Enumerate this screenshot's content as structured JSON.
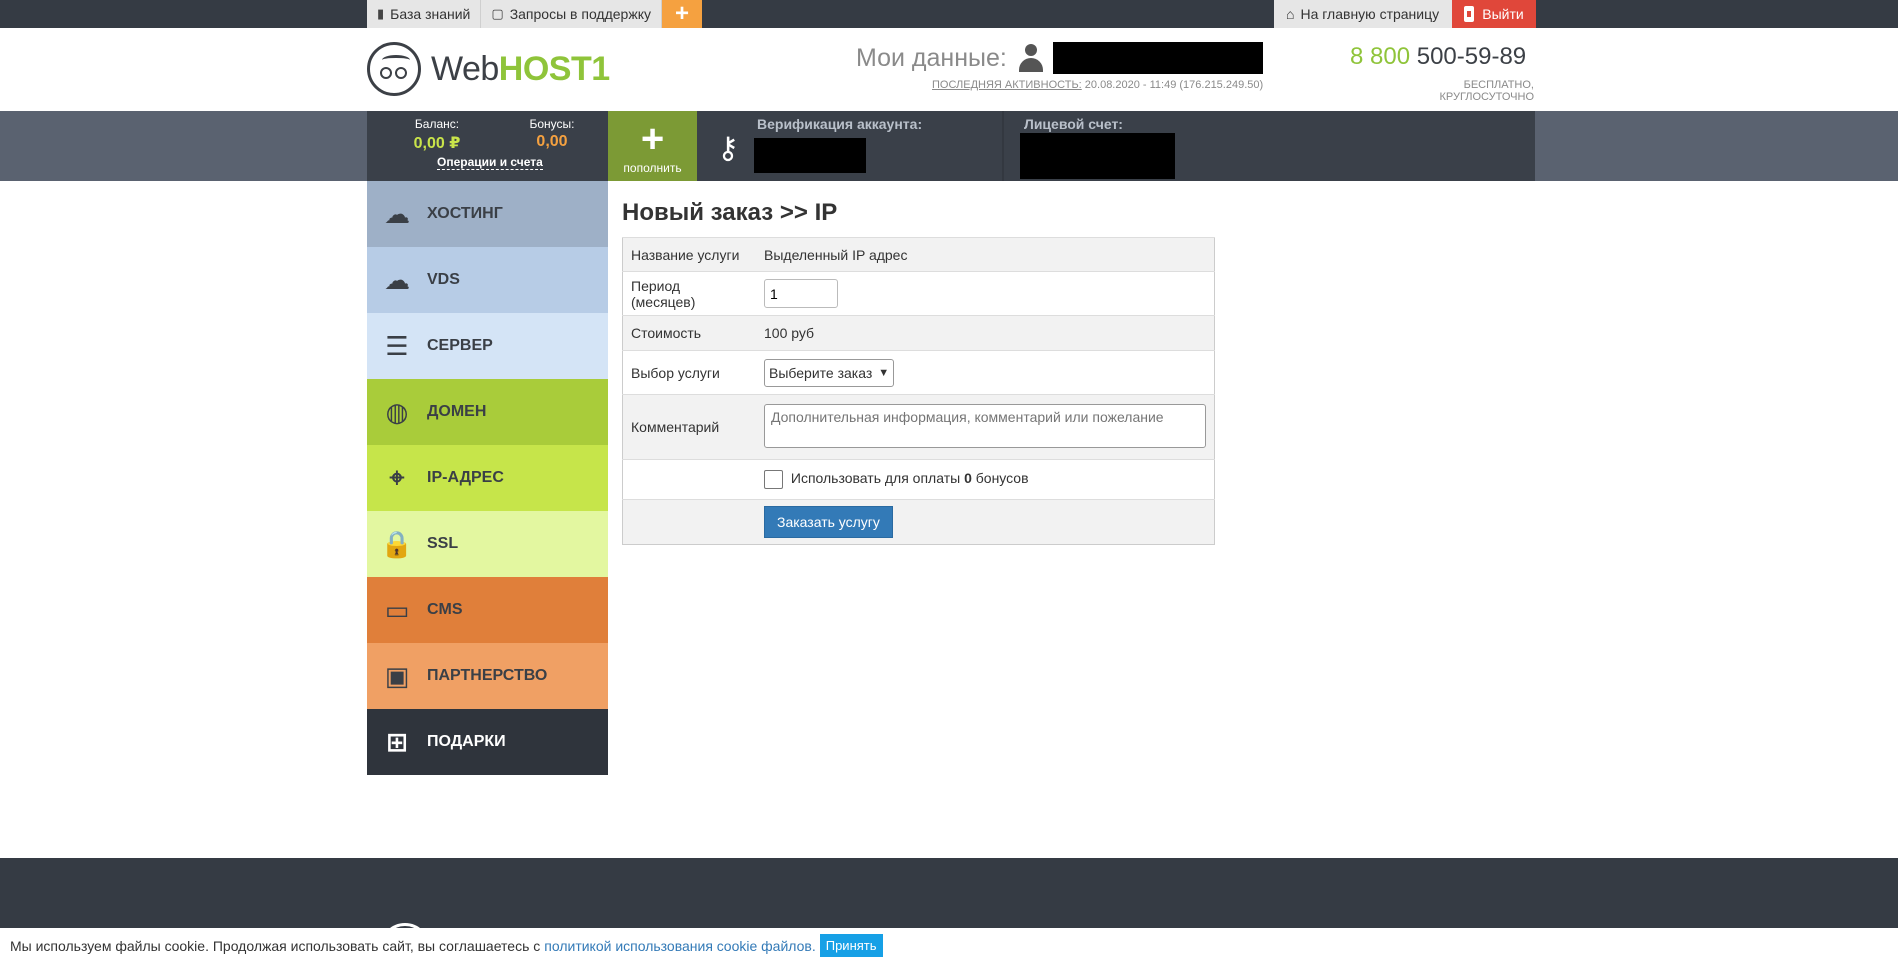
{
  "topbar": {
    "knowledge_base": "База знаний",
    "support_requests": "Запросы в поддержку",
    "plus": "+",
    "home": "На главную страницу",
    "logout": "Выйти"
  },
  "header": {
    "logo_web": "Web",
    "logo_host": "HOST1",
    "mydata_label": "Мои данные:",
    "activity_label": "ПОСЛЕДНЯЯ АКТИВНОСТЬ:",
    "activity_value": "20.08.2020 - 11:49 (176.215.249.50)",
    "phone_prefix": "8 800",
    "phone_number": "500-59-89",
    "phone_sub": "БЕСПЛАТНО, КРУГЛОСУТОЧНО"
  },
  "account": {
    "balance_label": "Баланс:",
    "balance_value": "0,00 ₽",
    "bonus_label": "Бонусы:",
    "bonus_value": "0,00",
    "operations_link": "Операции и счета",
    "topup_label": "пополнить",
    "topup_icon": "+",
    "verification_label": "Верификация аккаунта:",
    "personal_account_label": "Лицевой счет:"
  },
  "sidebar": {
    "items": [
      {
        "label": "ХОСТИНГ",
        "icon": "☁",
        "bg": "#9eb0c7"
      },
      {
        "label": "VDS",
        "icon": "☁",
        "bg": "#b7cce6"
      },
      {
        "label": "СЕРВЕР",
        "icon": "☰",
        "bg": "#d4e4f6"
      },
      {
        "label": "ДОМЕН",
        "icon": "◍",
        "bg": "#a9cc3a"
      },
      {
        "label": "IP-АДРЕС",
        "icon": "⌖",
        "bg": "#c6e54a"
      },
      {
        "label": "SSL",
        "icon": "🔒",
        "bg": "#e3f7a0"
      },
      {
        "label": "CMS",
        "icon": "▭",
        "bg": "#e07f3a"
      },
      {
        "label": "ПАРТНЕРСТВО",
        "icon": "▣",
        "bg": "#f0a064"
      },
      {
        "label": "ПОДАРКИ",
        "icon": "⊞",
        "bg": "#2f343c"
      }
    ]
  },
  "main": {
    "title": "Новый заказ >> IP",
    "rows": {
      "service_name_label": "Название услуги",
      "service_name_value": "Выделенный IP адрес",
      "period_label": "Период (месяцев)",
      "period_value": "1",
      "cost_label": "Стоимость",
      "cost_value": "100 руб",
      "service_choice_label": "Выбор услуги",
      "service_choice_value": "Выберите заказ",
      "comment_label": "Комментарий",
      "comment_placeholder": "Дополнительная информация, комментарий или пожелание",
      "bonus_use_prefix": "Использовать для оплаты",
      "bonus_use_count": "0",
      "bonus_use_suffix": "бонусов",
      "submit": "Заказать услугу"
    }
  },
  "cookie": {
    "text": "Мы используем файлы cookie. Продолжая использовать сайт, вы соглашаетесь с",
    "link": "политикой использования cookie файлов.",
    "accept": "Принять"
  }
}
